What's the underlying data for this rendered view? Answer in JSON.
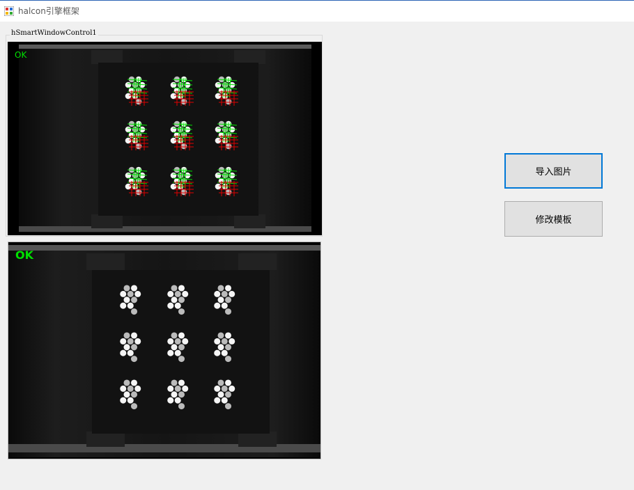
{
  "window": {
    "title": "halcon引擎框架",
    "icon": "windows-forms-app-icon"
  },
  "groupbox": {
    "label": "hSmartWindowControl1"
  },
  "viewer_top": {
    "status_text": "OK",
    "status_color": "#00e000",
    "content": "inspection image with green and red detection overlays on 9 clusters"
  },
  "viewer_bottom": {
    "status_text": "OK",
    "status_color": "#00e000"
  },
  "buttons": {
    "import_image": "导入图片",
    "edit_template": "修改模板"
  },
  "colors": {
    "accent": "#0078d7",
    "overlay_green": "#00e000",
    "overlay_red": "#e00000",
    "background": "#f0f0f0"
  }
}
